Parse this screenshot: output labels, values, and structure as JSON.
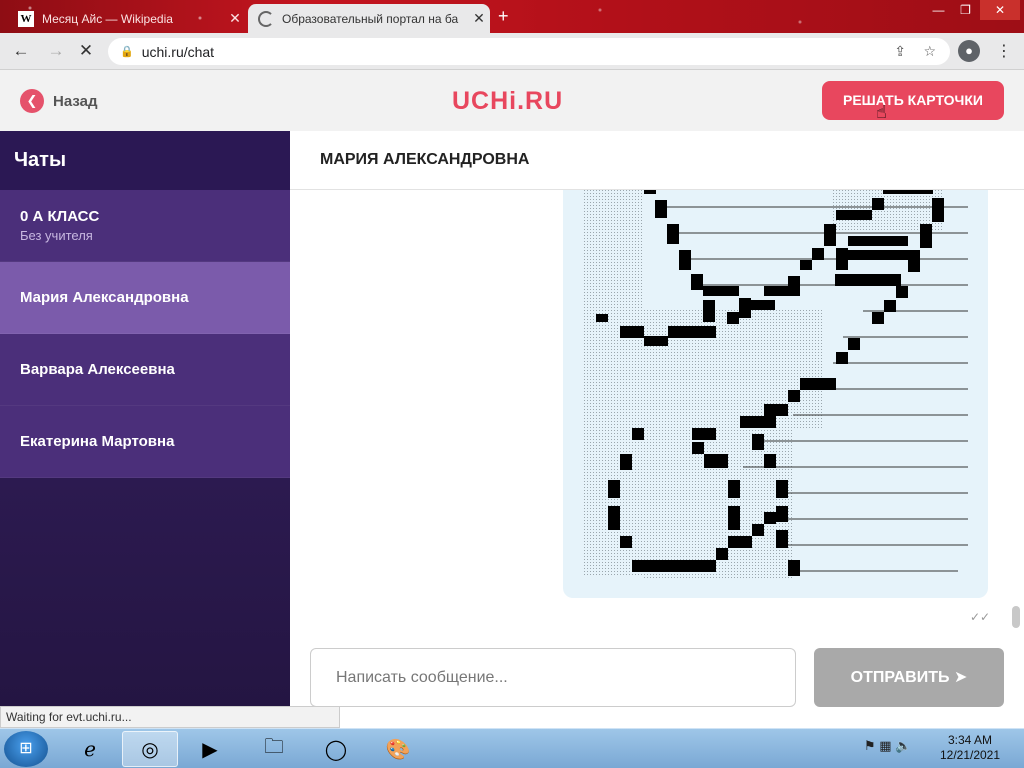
{
  "browser": {
    "tabs": [
      {
        "favicon": "W",
        "title": "Месяц Айс — Wikipedia",
        "close": "✕"
      },
      {
        "title": "Образовательный портал на ба",
        "close": "✕"
      }
    ],
    "new_tab": "+",
    "window_min": "—",
    "window_max": "❐",
    "window_close": "✕",
    "url": "uchi.ru/chat"
  },
  "header": {
    "back_label": "Назад",
    "logo": "UCHi.RU",
    "cards_button": "РЕШАТЬ КАРТОЧКИ"
  },
  "sidebar": {
    "title": "Чаты",
    "items": [
      {
        "label": "0 А КЛАСС",
        "sub": "Без учителя"
      },
      {
        "label": "Мария Александровна"
      },
      {
        "label": "Варвара Алексеевна"
      },
      {
        "label": "Екатерина Мартовна"
      }
    ]
  },
  "chat": {
    "title": "МАРИЯ АЛЕКСАНДРОВНА",
    "input_placeholder": "Написать сообщение...",
    "send_label": "ОТПРАВИТЬ",
    "read_mark": "✓✓"
  },
  "status_bar": "Waiting for evt.uchi.ru...",
  "taskbar": {
    "time": "3:34 AM",
    "date": "12/21/2021"
  }
}
